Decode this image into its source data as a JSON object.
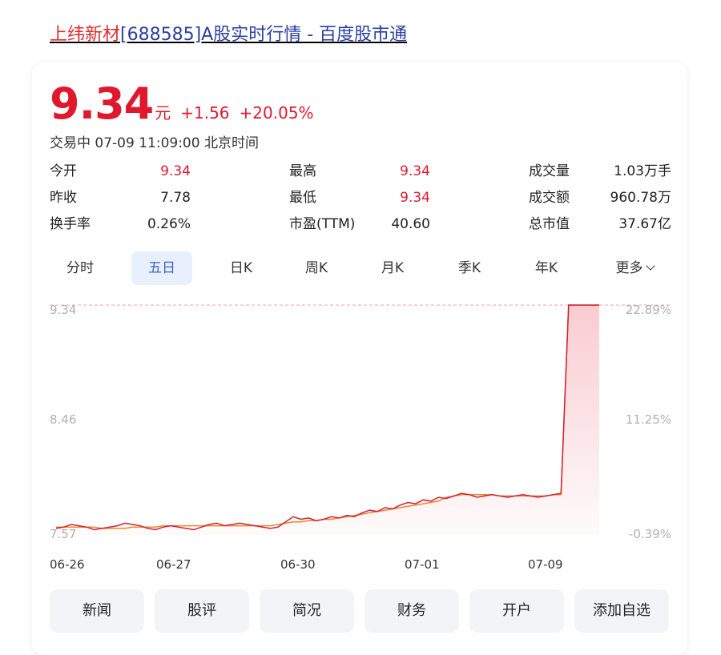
{
  "title": {
    "stock_name": "上纬新材",
    "rest": "[688585]A股实时行情 - 百度股市通"
  },
  "quote": {
    "price": "9.34",
    "unit": "元",
    "change": "+1.56",
    "change_pct": "+20.05%",
    "status": "交易中 07-09 11:09:00 北京时间"
  },
  "stats": [
    {
      "label": "今开",
      "value": "9.34",
      "color": "red"
    },
    {
      "label": "最高",
      "value": "9.34",
      "color": "red"
    },
    {
      "label": "成交量",
      "value": "1.03万手",
      "color": "black"
    },
    {
      "label": "昨收",
      "value": "7.78",
      "color": "black"
    },
    {
      "label": "最低",
      "value": "9.34",
      "color": "red"
    },
    {
      "label": "成交额",
      "value": "960.78万",
      "color": "black"
    },
    {
      "label": "换手率",
      "value": "0.26%",
      "color": "black"
    },
    {
      "label": "市盈(TTM)",
      "value": "40.60",
      "color": "black"
    },
    {
      "label": "总市值",
      "value": "37.67亿",
      "color": "black"
    }
  ],
  "tabs": [
    "分时",
    "五日",
    "日K",
    "周K",
    "月K",
    "季K",
    "年K",
    "更多"
  ],
  "active_tab": "五日",
  "chart_data": {
    "type": "line",
    "title": "",
    "y_left_ticks": [
      "9.34",
      "8.46",
      "7.57"
    ],
    "y_right_ticks": [
      "22.89%",
      "11.25%",
      "-0.39%"
    ],
    "x_ticks": [
      "06-26",
      "06-27",
      "06-30",
      "07-01",
      "07-09"
    ],
    "ylim": [
      7.57,
      9.34
    ],
    "series": [
      {
        "name": "",
        "color": "#d0233a",
        "values": [
          7.62,
          7.63,
          7.65,
          7.64,
          7.63,
          7.61,
          7.62,
          7.63,
          7.64,
          7.66,
          7.65,
          7.64,
          7.62,
          7.61,
          7.63,
          7.64,
          7.63,
          7.62,
          7.61,
          7.63,
          7.65,
          7.66,
          7.64,
          7.65,
          7.66,
          7.65,
          7.64,
          7.63,
          7.62,
          7.63,
          7.67,
          7.71,
          7.69,
          7.7,
          7.68,
          7.69,
          7.71,
          7.7,
          7.72,
          7.71,
          7.74,
          7.76,
          7.75,
          7.78,
          7.77,
          7.8,
          7.82,
          7.81,
          7.84,
          7.83,
          7.86,
          7.85,
          7.87,
          7.89,
          7.88,
          7.86,
          7.87,
          7.88,
          7.87,
          7.86,
          7.87,
          7.88,
          7.87,
          7.86,
          7.87,
          7.88,
          7.89,
          9.34,
          9.34,
          9.34,
          9.34,
          9.34
        ]
      },
      {
        "name": "",
        "color": "#e58a2c",
        "values": [
          7.63,
          7.63,
          7.63,
          7.63,
          7.63,
          7.63,
          7.62,
          7.62,
          7.62,
          7.62,
          7.63,
          7.63,
          7.63,
          7.63,
          7.64,
          7.64,
          7.64,
          7.64,
          7.64,
          7.64,
          7.64,
          7.64,
          7.64,
          7.64,
          7.64,
          7.64,
          7.64,
          7.64,
          7.64,
          7.65,
          7.66,
          7.67,
          7.67,
          7.68,
          7.68,
          7.69,
          7.69,
          7.7,
          7.71,
          7.72,
          7.73,
          7.74,
          7.75,
          7.76,
          7.77,
          7.78,
          7.79,
          7.8,
          7.81,
          7.82,
          7.83,
          7.86,
          7.87,
          7.88,
          7.88,
          7.88,
          7.88,
          7.88,
          7.87,
          7.87,
          7.87,
          7.87,
          7.87,
          7.87,
          7.87,
          7.88,
          7.88,
          9.34,
          9.34,
          9.34,
          9.34,
          9.34
        ]
      }
    ]
  },
  "buttons": [
    "新闻",
    "股评",
    "简况",
    "财务",
    "开户",
    "添加自选"
  ],
  "colors": {
    "up": "#e0182d",
    "active_tab": "#3b63c4",
    "link": "#2a3fa0"
  }
}
